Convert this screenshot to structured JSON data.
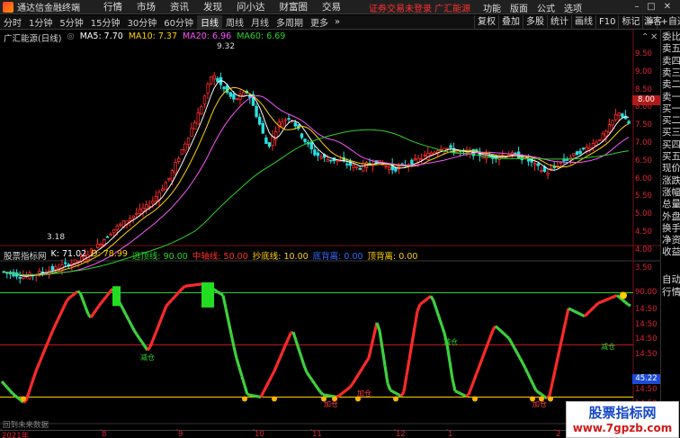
{
  "titlebar": {
    "app_name": "通达信金融终端",
    "menu": [
      "行情",
      "市场",
      "资讯",
      "发现",
      "问小达",
      "财富圈",
      "交易"
    ],
    "account": "证券交易未登录  广汇能源",
    "right_menu": [
      "功能",
      "版面",
      "公式",
      "选项"
    ]
  },
  "periods": {
    "tabs": [
      "分时",
      "1分钟",
      "5分钟",
      "15分钟",
      "30分钟",
      "60分钟",
      "日线",
      "周线",
      "月线",
      "多周期",
      "更多"
    ],
    "active": "日线",
    "tools": [
      "复权",
      "叠加",
      "多股",
      "统计",
      "画线",
      "F10",
      "标记"
    ],
    "self_select": "+自选",
    "own": "游客"
  },
  "main_legend": {
    "name": "广汇能源(日线)",
    "ma5": "MA5: 7.70",
    "ma10": "MA10: 7.37",
    "ma20": "MA20: 6.96",
    "ma60": "MA60: 6.69",
    "high_label": "9.32",
    "low_label": "3.18"
  },
  "sub_legend": {
    "name": "股票指标网",
    "k": "K: 71.02",
    "d": "D: 78.99",
    "escape": "逃顶线: 90.00",
    "mid": "中轴线: 50.00",
    "bottom": "抄底线: 10.00",
    "xline": "底背离: 0.00",
    "top_div": "顶背离: 0.00"
  },
  "price_axis": [
    "9.50",
    "9.00",
    "8.50",
    "8.00",
    "7.50",
    "7.00",
    "6.50",
    "6.00",
    "5.50",
    "5.00",
    "4.50",
    "4.00",
    "3.50"
  ],
  "osc_axis": [
    "90.00",
    "14:50",
    "14:50",
    "14:50",
    "14:50",
    "45.22",
    "14:50",
    "14:50",
    "15.00"
  ],
  "side_labels": [
    "委比",
    "卖五",
    "卖四",
    "卖三",
    "卖二",
    "卖一",
    "买一",
    "买二",
    "买三",
    "买四",
    "买五",
    "现价",
    "涨跌",
    "涨幅",
    "总量",
    "外盘",
    "换手",
    "净资",
    "收益",
    "自动",
    "行情"
  ],
  "annotations": {
    "reduce": "减仓",
    "add": "加仓"
  },
  "date_axis": [
    "2021年",
    "8",
    "9",
    "10",
    "11",
    "12",
    "1",
    "2"
  ],
  "future_label": "回到未来数据",
  "current_price": "8.00",
  "current_osc": "45.22",
  "watermark": {
    "line1": "股票指标网",
    "line2": "www.7gpzb.com"
  },
  "colors": {
    "up": "#ff2a2a",
    "down": "#3dd13d",
    "ma5": "#ffffff",
    "ma10": "#ffd400",
    "ma20": "#ff55ff",
    "ma60": "#2bd42b"
  }
}
